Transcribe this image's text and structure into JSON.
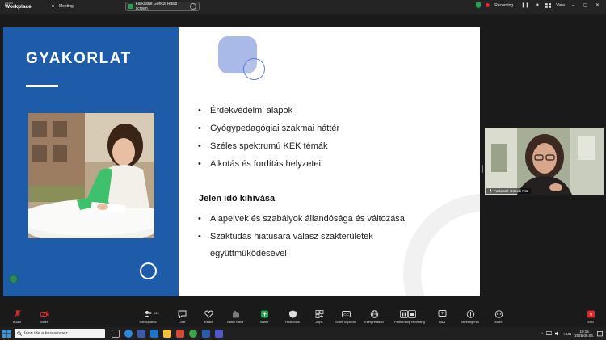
{
  "topbar": {
    "brand_small": "zoom",
    "brand_big": "Workplace",
    "meeting_label": "Meeting",
    "share_pill_label": "Farkasné Gönczi Rita's screen",
    "recording_label": "Recording...",
    "view_label": "View"
  },
  "slide": {
    "title": "GYAKORLAT",
    "bullets": [
      "Érdekvédelmi alapok",
      "Gyógypedagógiai szakmai háttér",
      "Széles spektrumú KÉK témák",
      "Alkotás és fordítás helyzetei"
    ],
    "sub_heading": "Jelen idő kihívása",
    "bullets2": [
      "Alapelvek és szabályok állandósága és változása",
      "Szaktudás hiátusára válasz szakterületek együttműködésével"
    ]
  },
  "video_tile": {
    "name": "Farkasné Gönczi Rita"
  },
  "toolbar": {
    "audio": "Audio",
    "video": "Video",
    "participants": "Participants",
    "participants_count": "120",
    "chat": "Chat",
    "react": "React",
    "raise_hand": "Raise hand",
    "share": "Share",
    "host_tools": "Host tools",
    "apps": "Apps",
    "show_captions": "Show captions",
    "interpretation": "Interpretation",
    "pause_stop_recording": "Pause/stop recording",
    "qa": "Q&A",
    "meeting_info": "Meeting info",
    "more": "More",
    "end": "End"
  },
  "taskbar": {
    "search_placeholder": "Írjon ide a kereséshez",
    "language": "HUN",
    "time": "10:15",
    "date": "2025.06.06."
  },
  "colors": {
    "slide_blue": "#1e5ba8",
    "record_red": "#e02828",
    "share_green": "#23a455",
    "end_red": "#e02828"
  }
}
